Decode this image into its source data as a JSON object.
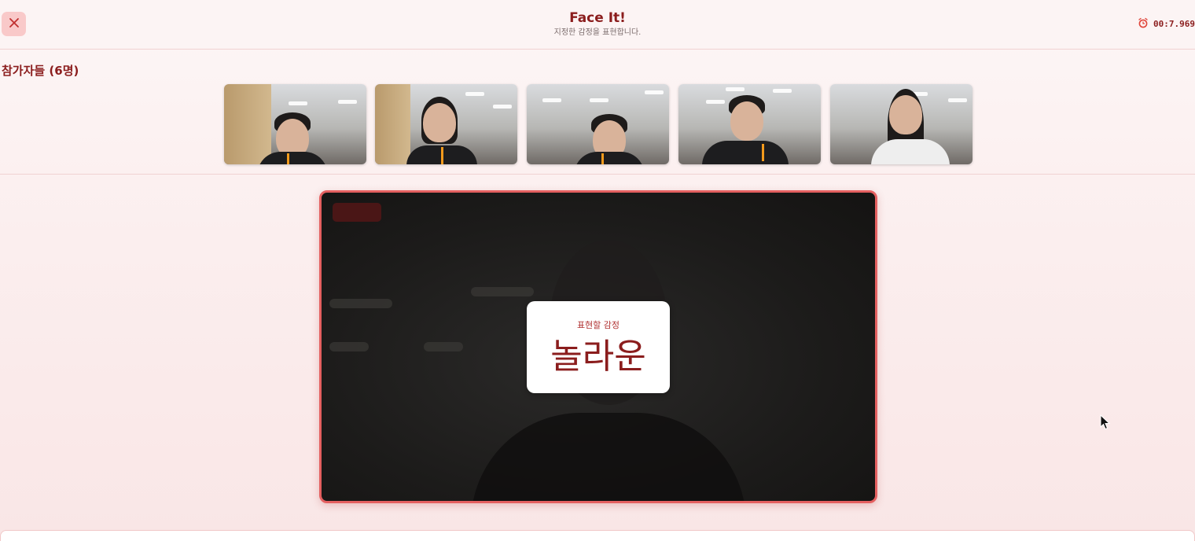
{
  "header": {
    "title": "Face It!",
    "subtitle": "지정한 감정을 표현합니다.",
    "timer": "00:7.969",
    "close_icon": "close-icon",
    "timer_icon": "alarm-clock-icon"
  },
  "participants": {
    "label": "참가자들 (6명)"
  },
  "main": {
    "emotion_label": "표현할 감정",
    "emotion_value": "놀라운"
  },
  "colors": {
    "accent": "#8b1d1d",
    "close_bg": "#f9c9c9",
    "video_border": "#e46060"
  }
}
